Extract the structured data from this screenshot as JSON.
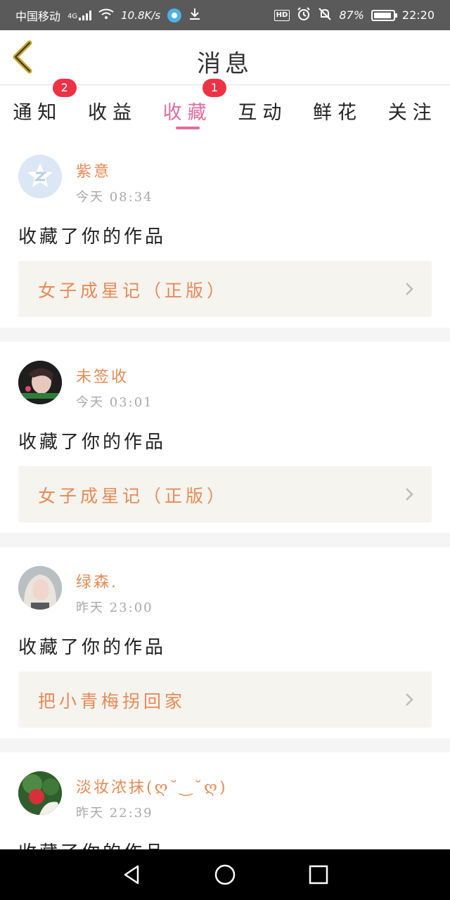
{
  "status_bar": {
    "carrier": "中国移动",
    "network_type": "4G",
    "speed": "10.8K/s",
    "hd_label": "HD",
    "battery_percent": "87%",
    "time": "22:20"
  },
  "header": {
    "title": "消息"
  },
  "tabs": [
    {
      "label": "通知",
      "badge": "2",
      "active": false
    },
    {
      "label": "收益",
      "badge": "",
      "active": false
    },
    {
      "label": "收藏",
      "badge": "1",
      "active": true
    },
    {
      "label": "互动",
      "badge": "",
      "active": false
    },
    {
      "label": "鲜花",
      "badge": "",
      "active": false
    },
    {
      "label": "关注",
      "badge": "",
      "active": false
    }
  ],
  "messages": [
    {
      "user": "紫意",
      "time": "今天  08:34",
      "text": "收藏了你的作品",
      "work": "女子成星记（正版）",
      "avatar": "default-avatar"
    },
    {
      "user": "未签收",
      "time": "今天  03:01",
      "text": "收藏了你的作品",
      "work": "女子成星记（正版）",
      "avatar": "photo-avatar"
    },
    {
      "user": "绿森.",
      "time": "昨天  23:00",
      "text": "收藏了你的作品",
      "work": "把小青梅拐回家",
      "avatar": "photo-avatar"
    },
    {
      "user": "淡妆浓抹(ღ˘‿˘ღ)",
      "time": "昨天  22:39",
      "text": "收藏了你的作品",
      "work": "",
      "avatar": "photo-avatar"
    }
  ],
  "colors": {
    "accent_pink": "#e26b9f",
    "orange_text": "#e88a55",
    "badge_red": "#ee3246",
    "status_bar_bg": "#5a5a5a"
  }
}
